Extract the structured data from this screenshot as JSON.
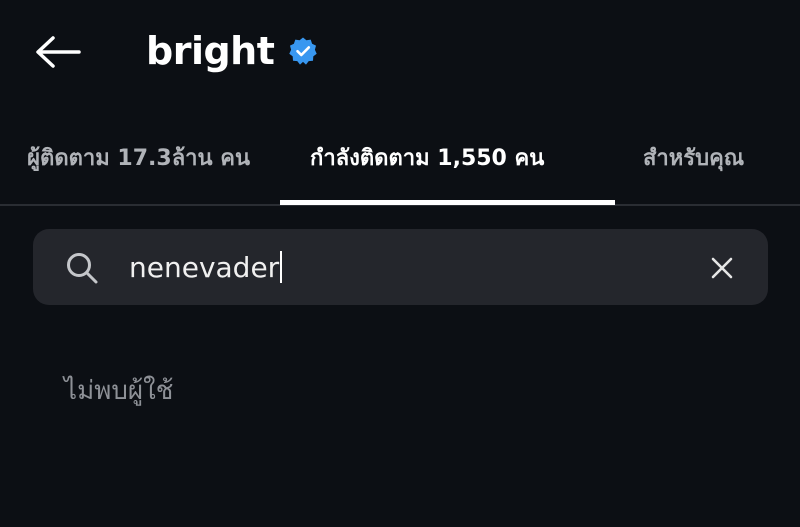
{
  "header": {
    "back_icon": "arrow-left-icon",
    "title": "bright",
    "verified_icon": "verified-badge-icon",
    "verified_color": "#3897f0"
  },
  "tabs": [
    {
      "label": "ผู้ติดตาม 17.3ล้าน คน",
      "active": false
    },
    {
      "label": "กำลังติดตาม 1,550 คน",
      "active": true
    },
    {
      "label": "สำหรับคุณ",
      "active": false
    }
  ],
  "search": {
    "icon": "search-icon",
    "value": "nenevader",
    "clear_icon": "close-icon"
  },
  "results": {
    "empty_message": "ไม่พบผู้ใช้"
  },
  "colors": {
    "background": "#0c0f14",
    "search_bg": "#24262c",
    "muted_text": "#8e9197"
  }
}
